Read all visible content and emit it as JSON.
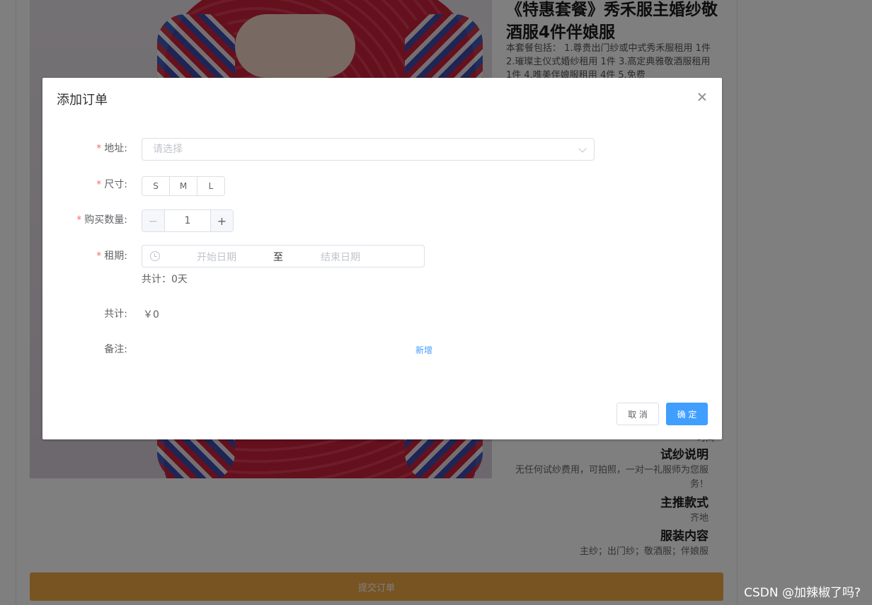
{
  "product": {
    "title": "《特惠套餐》秀禾服主婚纱敬酒服4件伴娘服",
    "description": "本套餐包括： 1.尊贵出门纱或中式秀禾服租用 1件 2.璀璨主仪式婚纱租用 1件 3.高定典雅敬酒服租用 1件 4.唯美伴娘服租用 4件 5.免费"
  },
  "info": {
    "small_text": "时间",
    "trial_title": "试纱说明",
    "trial_text": "无任何试纱费用，可拍照，一对一礼服师为您服务！",
    "style_title": "主推款式",
    "style_text": "齐地",
    "content_title": "服装内容",
    "content_text": "主纱；出门纱；敬酒服；伴娘服"
  },
  "submit_bar": {
    "label": "提交订单"
  },
  "watermark": "CSDN @加辣椒了吗?",
  "dialog": {
    "title": "添加订单",
    "fields": {
      "address": {
        "label": "地址:",
        "placeholder": "请选择"
      },
      "size": {
        "label": "尺寸:",
        "options": [
          "S",
          "M",
          "L"
        ]
      },
      "quantity": {
        "label": "购买数量:",
        "value": "1",
        "minus": "−",
        "plus": "+"
      },
      "rental": {
        "label": "租期:",
        "start_placeholder": "开始日期",
        "separator": "至",
        "end_placeholder": "结束日期",
        "days_total": "共计：0天"
      },
      "total": {
        "label": "共计:",
        "value": "￥0"
      },
      "remark": {
        "label": "备注:",
        "add_link": "新增"
      }
    },
    "buttons": {
      "cancel": "取 消",
      "confirm": "确 定"
    }
  },
  "colors": {
    "primary": "#409eff",
    "required": "#f56c6c",
    "submit_bar": "#f1a846",
    "overlay": "rgba(0,0,0,0.5)"
  }
}
